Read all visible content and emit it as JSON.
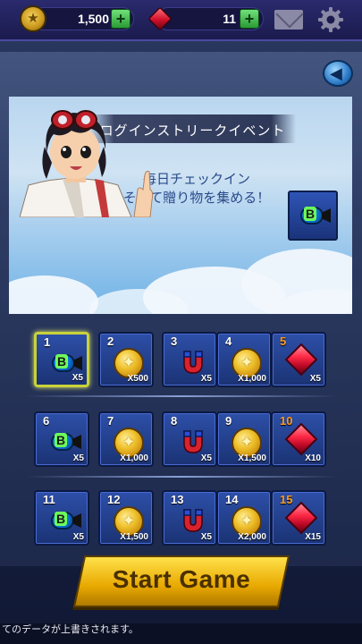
{
  "topbar": {
    "coins": "1,500",
    "gems": "11"
  },
  "banner": {
    "title": "ログインストリークイベント",
    "message_line1": "毎日チェックイン",
    "message_line2": "そして贈り物を集める！"
  },
  "days": [
    {
      "day": "1",
      "item": "bomb-icon",
      "qty": "X5",
      "special": false,
      "selected": true
    },
    {
      "day": "2",
      "item": "coin-icon",
      "qty": "X500",
      "special": false,
      "selected": false
    },
    {
      "day": "3",
      "item": "magnet-icon",
      "qty": "X5",
      "special": false,
      "selected": false
    },
    {
      "day": "4",
      "item": "coin-icon",
      "qty": "X1,000",
      "special": false,
      "selected": false
    },
    {
      "day": "5",
      "item": "gem-icon",
      "qty": "X5",
      "special": true,
      "selected": false
    },
    {
      "day": "6",
      "item": "bomb-icon",
      "qty": "X5",
      "special": false,
      "selected": false
    },
    {
      "day": "7",
      "item": "coin-icon",
      "qty": "X1,000",
      "special": false,
      "selected": false
    },
    {
      "day": "8",
      "item": "magnet-icon",
      "qty": "X5",
      "special": false,
      "selected": false
    },
    {
      "day": "9",
      "item": "coin-icon",
      "qty": "X1,500",
      "special": false,
      "selected": false
    },
    {
      "day": "10",
      "item": "gem-icon",
      "qty": "X10",
      "special": true,
      "selected": false
    },
    {
      "day": "11",
      "item": "bomb-icon",
      "qty": "X5",
      "special": false,
      "selected": false
    },
    {
      "day": "12",
      "item": "coin-icon",
      "qty": "X1,500",
      "special": false,
      "selected": false
    },
    {
      "day": "13",
      "item": "magnet-icon",
      "qty": "X5",
      "special": false,
      "selected": false
    },
    {
      "day": "14",
      "item": "coin-icon",
      "qty": "X2,000",
      "special": false,
      "selected": false
    },
    {
      "day": "15",
      "item": "gem-icon",
      "qty": "X15",
      "special": true,
      "selected": false
    }
  ],
  "start_button": {
    "label": "Start Game"
  },
  "footer": {
    "note": "てのデータが上書きされます。"
  },
  "colors": {
    "accent_gold": "#e8a800",
    "cell_blue": "#2d4fa8",
    "special_day": "#ff9a1e",
    "selected_border": "#c8d23a"
  }
}
